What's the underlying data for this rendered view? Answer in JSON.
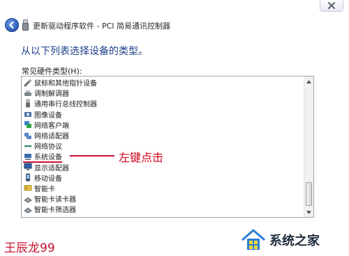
{
  "window": {
    "close_icon": "close-icon"
  },
  "header": {
    "title": "更新驱动程序软件 - PCI 简易通讯控制器",
    "back_icon": "back-arrow-icon",
    "device_icon": "usb-device-icon"
  },
  "main": {
    "title": "从以下列表选择设备的类型。",
    "list_label": "常见硬件类型(H):",
    "items": [
      {
        "label": "鼠标和其他指针设备",
        "icon": "mouse-icon"
      },
      {
        "label": "调制解调器",
        "icon": "modem-icon"
      },
      {
        "label": "通用串行总线控制器",
        "icon": "usb-icon"
      },
      {
        "label": "图像设备",
        "icon": "camera-icon"
      },
      {
        "label": "网络客户端",
        "icon": "network-client-icon"
      },
      {
        "label": "网络适配器",
        "icon": "network-adapter-icon"
      },
      {
        "label": "网络协议",
        "icon": "network-protocol-icon"
      },
      {
        "label": "系统设备",
        "icon": "system-device-icon"
      },
      {
        "label": "显示适配器",
        "icon": "display-adapter-icon"
      },
      {
        "label": "移动设备",
        "icon": "mobile-device-icon"
      },
      {
        "label": "智能卡",
        "icon": "smart-card-icon"
      },
      {
        "label": "智能卡读卡器",
        "icon": "card-reader-icon"
      },
      {
        "label": "智能卡筛选器",
        "icon": "card-filter-icon"
      }
    ]
  },
  "annotation": {
    "text": "左键点击",
    "color": "#d0021b"
  },
  "watermarks": {
    "left": "王辰龙99",
    "right": "系统之家"
  }
}
